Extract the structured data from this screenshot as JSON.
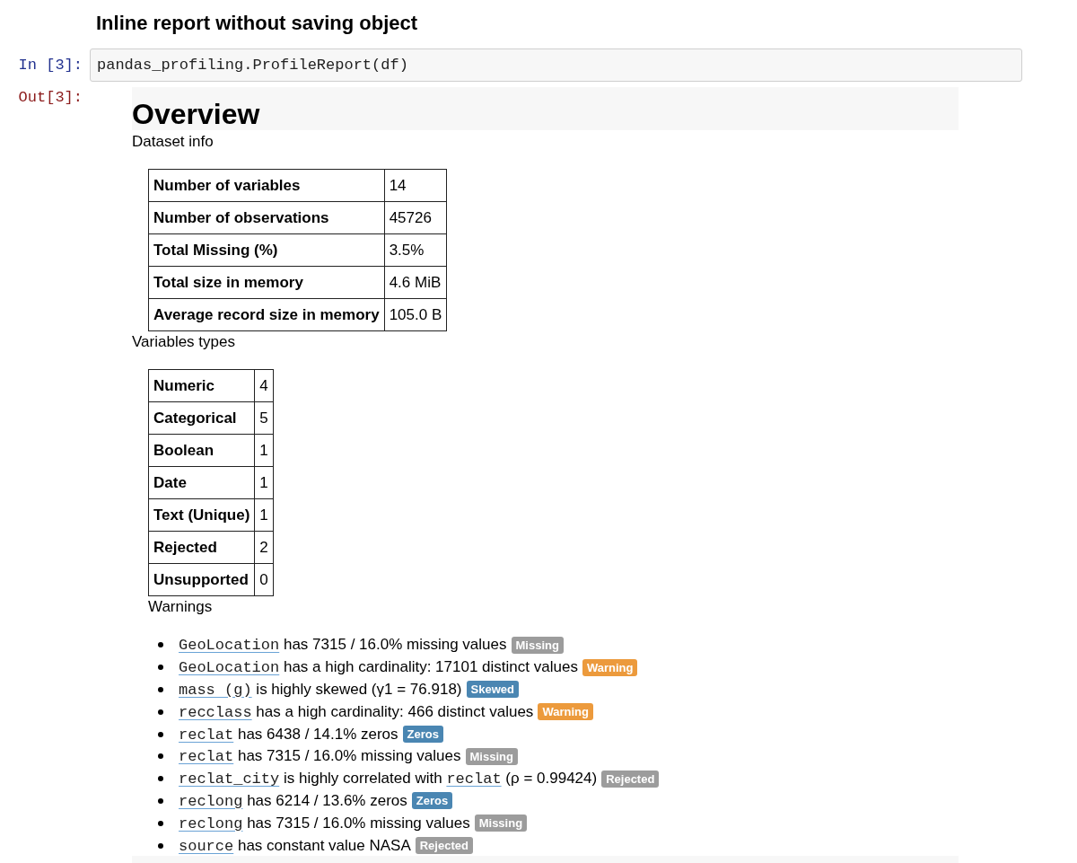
{
  "notebook": {
    "heading": "Inline report without saving object"
  },
  "input_cell": {
    "prompt": "In [3]:",
    "code": "pandas_profiling.ProfileReport(df)"
  },
  "output_cell": {
    "prompt": "Out[3]:",
    "report": {
      "title": "Overview",
      "dataset_info": {
        "title": "Dataset info",
        "rows": [
          {
            "label": "Number of variables",
            "value": "14"
          },
          {
            "label": "Number of observations",
            "value": "45726"
          },
          {
            "label": "Total Missing (%)",
            "value": "3.5%"
          },
          {
            "label": "Total size in memory",
            "value": "4.6 MiB"
          },
          {
            "label": "Average record size in memory",
            "value": "105.0 B"
          }
        ]
      },
      "variable_types": {
        "title": "Variables types",
        "rows": [
          {
            "label": "Numeric",
            "value": "4"
          },
          {
            "label": "Categorical",
            "value": "5"
          },
          {
            "label": "Boolean",
            "value": "1"
          },
          {
            "label": "Date",
            "value": "1"
          },
          {
            "label": "Text (Unique)",
            "value": "1"
          },
          {
            "label": "Rejected",
            "value": "2"
          },
          {
            "label": "Unsupported",
            "value": "0"
          }
        ]
      },
      "warnings": {
        "title": "Warnings",
        "items": [
          {
            "segments": [
              {
                "kind": "variable",
                "text": "GeoLocation"
              },
              {
                "kind": "text",
                "text": "has 7315 / 16.0% missing values"
              }
            ],
            "badge": {
              "label": "Missing",
              "color": "#9c9c9c"
            }
          },
          {
            "segments": [
              {
                "kind": "variable",
                "text": "GeoLocation"
              },
              {
                "kind": "text",
                "text": "has a high cardinality: 17101 distinct values"
              }
            ],
            "badge": {
              "label": "Warning",
              "color": "#ec9a3c"
            }
          },
          {
            "segments": [
              {
                "kind": "variable",
                "text": "mass (g)"
              },
              {
                "kind": "text",
                "text": "is highly skewed (γ1 = 76.918)"
              }
            ],
            "badge": {
              "label": "Skewed",
              "color": "#4a86b2"
            }
          },
          {
            "segments": [
              {
                "kind": "variable",
                "text": "recclass"
              },
              {
                "kind": "text",
                "text": "has a high cardinality: 466 distinct values"
              }
            ],
            "badge": {
              "label": "Warning",
              "color": "#ec9a3c"
            }
          },
          {
            "segments": [
              {
                "kind": "variable",
                "text": "reclat"
              },
              {
                "kind": "text",
                "text": "has 6438 / 14.1% zeros"
              }
            ],
            "badge": {
              "label": "Zeros",
              "color": "#4a86b2"
            }
          },
          {
            "segments": [
              {
                "kind": "variable",
                "text": "reclat"
              },
              {
                "kind": "text",
                "text": "has 7315 / 16.0% missing values"
              }
            ],
            "badge": {
              "label": "Missing",
              "color": "#9c9c9c"
            }
          },
          {
            "segments": [
              {
                "kind": "variable",
                "text": "reclat_city"
              },
              {
                "kind": "text",
                "text": "is highly correlated with"
              },
              {
                "kind": "variable",
                "text": "reclat"
              },
              {
                "kind": "text",
                "text": "(ρ = 0.99424)"
              }
            ],
            "badge": {
              "label": "Rejected",
              "color": "#9c9c9c"
            }
          },
          {
            "segments": [
              {
                "kind": "variable",
                "text": "reclong"
              },
              {
                "kind": "text",
                "text": "has 6214 / 13.6% zeros"
              }
            ],
            "badge": {
              "label": "Zeros",
              "color": "#4a86b2"
            }
          },
          {
            "segments": [
              {
                "kind": "variable",
                "text": "reclong"
              },
              {
                "kind": "text",
                "text": "has 7315 / 16.0% missing values"
              }
            ],
            "badge": {
              "label": "Missing",
              "color": "#9c9c9c"
            }
          },
          {
            "segments": [
              {
                "kind": "variable",
                "text": "source"
              },
              {
                "kind": "text",
                "text": "has constant value NASA"
              }
            ],
            "badge": {
              "label": "Rejected",
              "color": "#9c9c9c"
            }
          }
        ]
      }
    }
  }
}
